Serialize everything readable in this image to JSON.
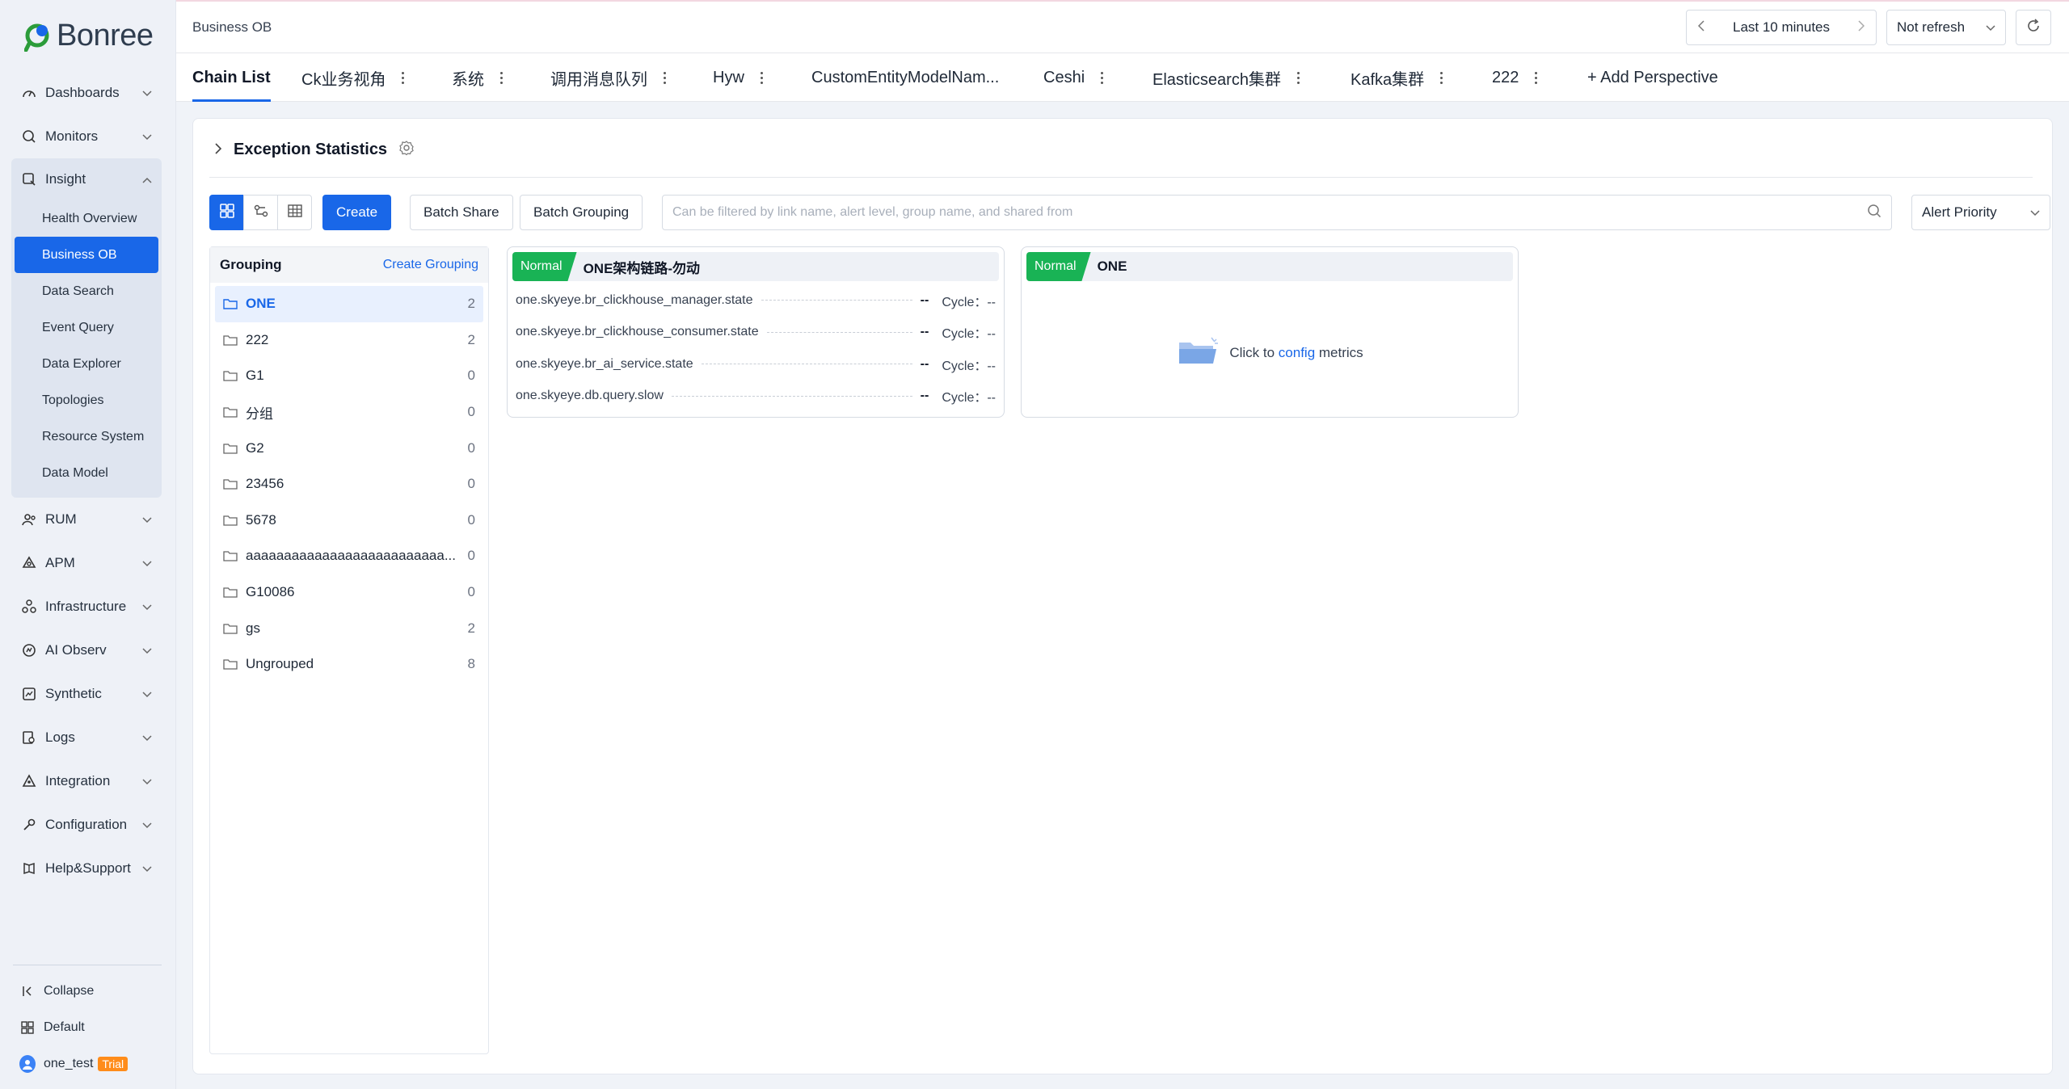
{
  "colors": {
    "accent": "#1967e8",
    "normal": "#19b355",
    "trial": "#ff8c1a"
  },
  "brand": {
    "name": "Bonree"
  },
  "sidebar": {
    "items": [
      {
        "label": "Dashboards",
        "icon": "dashboard-icon"
      },
      {
        "label": "Monitors",
        "icon": "monitor-icon"
      },
      {
        "label": "Insight",
        "icon": "insight-icon"
      },
      {
        "label": "RUM",
        "icon": "rum-icon"
      },
      {
        "label": "APM",
        "icon": "apm-icon"
      },
      {
        "label": "Infrastructure",
        "icon": "infrastructure-icon"
      },
      {
        "label": "AI Observ",
        "icon": "ai-observ-icon"
      },
      {
        "label": "Synthetic",
        "icon": "synthetic-icon"
      },
      {
        "label": "Logs",
        "icon": "logs-icon"
      },
      {
        "label": "Integration",
        "icon": "integration-icon"
      },
      {
        "label": "Configuration",
        "icon": "configuration-icon"
      },
      {
        "label": "Help&Support",
        "icon": "help-icon"
      }
    ],
    "insight_sub": [
      "Health Overview",
      "Business OB",
      "Data Search",
      "Event Query",
      "Data Explorer",
      "Topologies",
      "Resource System",
      "Data Model"
    ],
    "collapse": "Collapse",
    "default": "Default",
    "user": "one_test",
    "trial": "Trial"
  },
  "header": {
    "breadcrumb": "Business OB",
    "time_range": "Last 10 minutes",
    "refresh": "Not refresh"
  },
  "tabs": [
    {
      "label": "Chain List",
      "more": false
    },
    {
      "label": "Ck业务视角",
      "more": true
    },
    {
      "label": "系统",
      "more": true
    },
    {
      "label": "调用消息队列",
      "more": true
    },
    {
      "label": "Hyw",
      "more": true
    },
    {
      "label": "CustomEntityModelNam...",
      "more": false
    },
    {
      "label": "Ceshi",
      "more": true
    },
    {
      "label": "Elasticsearch集群",
      "more": true
    },
    {
      "label": "Kafka集群",
      "more": true
    },
    {
      "label": "222",
      "more": true
    }
  ],
  "add_perspective": "+ Add Perspective",
  "exception": {
    "title": "Exception Statistics"
  },
  "toolbar": {
    "create": "Create",
    "batch_share": "Batch Share",
    "batch_grouping": "Batch Grouping",
    "search_placeholder": "Can be filtered by link name, alert level, group name, and shared from",
    "priority": "Alert Priority"
  },
  "grouping": {
    "title": "Grouping",
    "create": "Create Grouping",
    "items": [
      {
        "name": "ONE",
        "count": "2"
      },
      {
        "name": "222",
        "count": "2"
      },
      {
        "name": "G1",
        "count": "0"
      },
      {
        "name": "分组",
        "count": "0"
      },
      {
        "name": "G2",
        "count": "0"
      },
      {
        "name": "23456",
        "count": "0"
      },
      {
        "name": "5678",
        "count": "0"
      },
      {
        "name": "aaaaaaaaaaaaaaaaaaaaaaaaaa...",
        "count": "0"
      },
      {
        "name": "G10086",
        "count": "0"
      },
      {
        "name": "gs",
        "count": "2"
      },
      {
        "name": "Ungrouped",
        "count": "8"
      }
    ]
  },
  "cards": [
    {
      "status": "Normal",
      "name": "ONE架构链路-勿动",
      "metrics": [
        {
          "name": "one.skyeye.br_clickhouse_manager.state",
          "value": "--",
          "cycle": "Cycle：--"
        },
        {
          "name": "one.skyeye.br_clickhouse_consumer.state",
          "value": "--",
          "cycle": "Cycle：--"
        },
        {
          "name": "one.skyeye.br_ai_service.state",
          "value": "--",
          "cycle": "Cycle：--"
        },
        {
          "name": "one.skyeye.db.query.slow",
          "value": "--",
          "cycle": "Cycle：--"
        }
      ]
    },
    {
      "status": "Normal",
      "name": "ONE",
      "empty": {
        "prefix": "Click to",
        "link": "config",
        "suffix": "metrics"
      }
    }
  ]
}
